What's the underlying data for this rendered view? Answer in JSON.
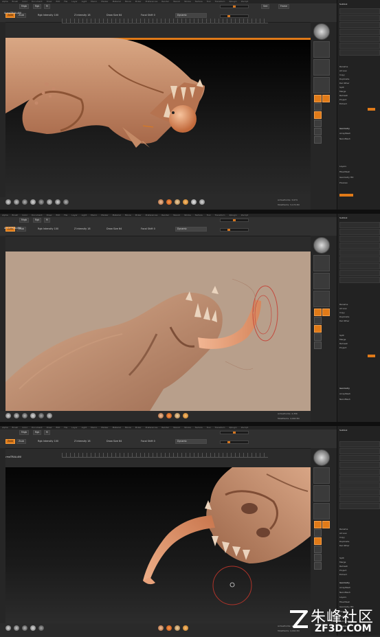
{
  "menu": [
    "Alpha",
    "Brush",
    "Color",
    "Document",
    "Draw",
    "Edit",
    "File",
    "Layer",
    "Light",
    "Macro",
    "Marker",
    "Material",
    "Movie",
    "Picker",
    "Preferences",
    "Render",
    "Stencil",
    "Stroke",
    "Texture",
    "Tool",
    "Transform",
    "Zplugin",
    "Zscript"
  ],
  "panels": [
    {
      "doc_title": "ArmaTRAA.ANI",
      "toolbar": {
        "mrgb": "Mrgb",
        "rgb": "Rgb",
        "m": "M",
        "zadd": "Zadd",
        "zsub": "Zsub",
        "rgb_intensity": "Rgb Intensity 100",
        "z_intensity": "Z Intensity 18",
        "draw_size": "Draw Size 64",
        "focal_shift": "Focal Shift 0",
        "dynamic": "Dynamic",
        "active_points": "ActivePoints: 3,674",
        "total_points": "TotalPoints: 3,174 Mil"
      },
      "zoom": "Default"
    },
    {
      "doc_title": "ArmaTRAA.ANI",
      "toolbar": {
        "mrgb": "Mrgb",
        "rgb": "Rgb",
        "m": "M",
        "zadd": "Zadd",
        "zsub": "Zsub",
        "rgb_intensity": "Rgb Intensity 100",
        "z_intensity": "Z Intensity 18",
        "draw_size": "Draw Size 64",
        "focal_shift": "Focal Shift 0",
        "dynamic": "Dynamic",
        "active_points": "ActivePoints: 4,356",
        "total_points": "TotalPoints: 4,002 Mil"
      },
      "zoom": "Default"
    },
    {
      "doc_title": "ArmaTRAA.ANI",
      "toolbar": {
        "mrgb": "Mrgb",
        "rgb": "Rgb",
        "m": "M",
        "zadd": "Zadd",
        "zsub": "Zsub",
        "rgb_intensity": "Rgb Intensity 100",
        "z_intensity": "Z Intensity 18",
        "draw_size": "Draw Size 64",
        "focal_shift": "Focal Shift 0",
        "dynamic": "Dynamic",
        "active_points": "ActivePoints: 4,356",
        "total_points": "TotalPoints: 4,002 Mil"
      },
      "zoom": "Default"
    }
  ],
  "tray": {
    "subtool_header": "Subtool",
    "items": [
      "Rename",
      "AutoReorder",
      "All Low",
      "All High",
      "Copy",
      "Paste",
      "Duplicate",
      "Append",
      "Insert",
      "Del Other",
      "Delete",
      "Del All",
      "Split",
      "Merge",
      "Remesh",
      "Project",
      "Extract"
    ],
    "sections": [
      "Geometry",
      "ArrayMesh",
      "NanoMesh",
      "Layers",
      "FiberMesh",
      "Geometry HD",
      "Preview",
      "Surface",
      "Deformation",
      "Masking",
      "Visibility",
      "Polygroups"
    ]
  },
  "colors": {
    "accent": "#e07a18",
    "ui_bg": "#2b2b2b",
    "clay": "#c98f6a"
  },
  "watermark": {
    "cn": "朱峰社区",
    "url": "ZF3D.COM"
  }
}
